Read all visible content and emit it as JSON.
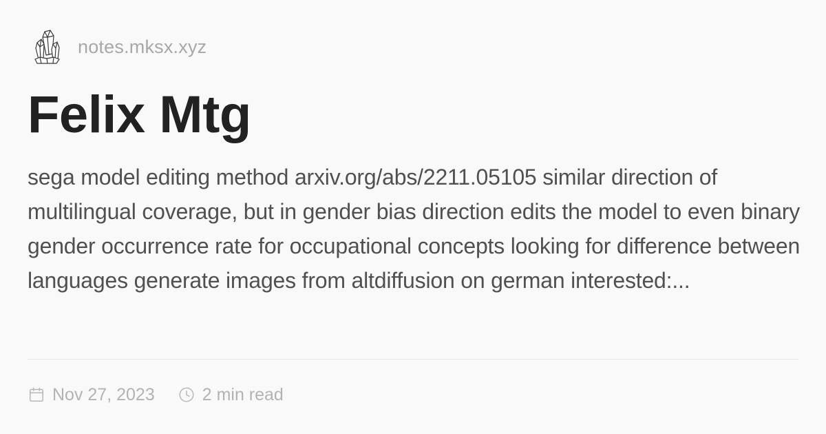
{
  "site": {
    "name": "notes.mksx.xyz",
    "logo_icon": "crystal-cluster-icon"
  },
  "post": {
    "title": "Felix Mtg",
    "excerpt": "sega model editing method arxiv.org/abs/2211.05105 similar direction of multilingual coverage, but in gender bias direction edits the model to even binary gender occurrence rate for occupational concepts looking for difference between languages generate images from altdiffusion on german interested:...",
    "date": "Nov 27, 2023",
    "date_icon": "calendar-icon",
    "read_time": "2 min read",
    "read_time_icon": "clock-icon"
  },
  "colors": {
    "background": "#faf9fa",
    "title": "#222222",
    "excerpt": "#505050",
    "muted": "#a8a8a8",
    "divider": "#e8e6e8"
  }
}
